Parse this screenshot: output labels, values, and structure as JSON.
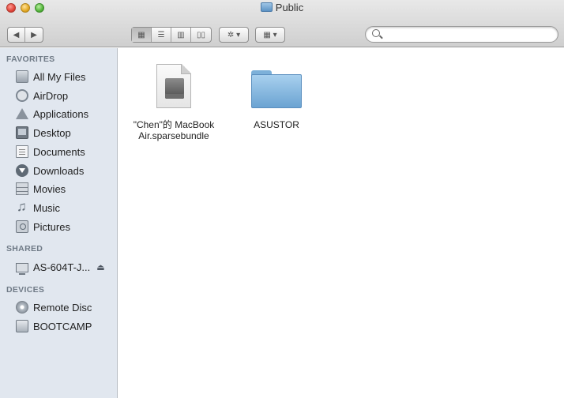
{
  "window": {
    "title": "Public"
  },
  "toolbar": {
    "back_icon": "back-arrow-icon",
    "forward_icon": "forward-arrow-icon",
    "view_modes": [
      "icon-view-icon",
      "list-view-icon",
      "column-view-icon",
      "coverflow-view-icon"
    ],
    "action_icon": "gear-icon",
    "arrange_icon": "arrange-icon",
    "search": {
      "value": "",
      "placeholder": ""
    }
  },
  "sidebar": {
    "sections": [
      {
        "title": "FAVORITES",
        "items": [
          {
            "label": "All My Files",
            "icon": "all-files-icon"
          },
          {
            "label": "AirDrop",
            "icon": "airdrop-icon"
          },
          {
            "label": "Applications",
            "icon": "applications-icon"
          },
          {
            "label": "Desktop",
            "icon": "desktop-icon"
          },
          {
            "label": "Documents",
            "icon": "documents-icon"
          },
          {
            "label": "Downloads",
            "icon": "downloads-icon"
          },
          {
            "label": "Movies",
            "icon": "movies-icon"
          },
          {
            "label": "Music",
            "icon": "music-icon"
          },
          {
            "label": "Pictures",
            "icon": "pictures-icon"
          }
        ]
      },
      {
        "title": "SHARED",
        "items": [
          {
            "label": "AS-604T-J...",
            "icon": "server-icon",
            "eject": "eject-icon"
          }
        ]
      },
      {
        "title": "DEVICES",
        "items": [
          {
            "label": "Remote Disc",
            "icon": "disc-icon"
          },
          {
            "label": "BOOTCAMP",
            "icon": "disk-icon"
          }
        ]
      }
    ]
  },
  "content": {
    "files": [
      {
        "line1": "\"Chen\"的 MacBook",
        "line2": "Air.sparsebundle",
        "icon": "sparsebundle-icon"
      },
      {
        "line1": "ASUSTOR",
        "line2": "",
        "icon": "folder-icon"
      }
    ]
  }
}
